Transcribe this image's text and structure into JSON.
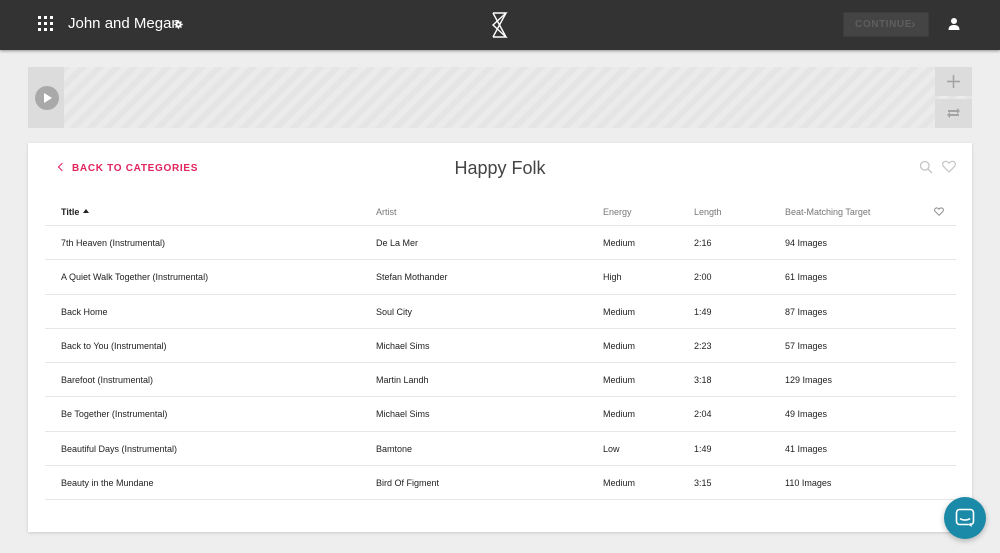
{
  "header": {
    "project_title": "John and Megan",
    "continue_label": "CONTINUE",
    "icons": {
      "apps": "apps-grid-icon",
      "settings": "gear-icon",
      "logo": "logo-icon",
      "user": "user-icon"
    }
  },
  "timeline": {
    "icons": {
      "play": "play-icon",
      "add": "plus-icon",
      "loop": "repeat-icon"
    }
  },
  "panel": {
    "back_label": "BACK TO CATEGORIES",
    "title": "Happy Folk",
    "icons": {
      "search": "search-icon",
      "favorites": "heart-icon"
    },
    "columns": {
      "title": "Title",
      "artist": "Artist",
      "energy": "Energy",
      "length": "Length",
      "beat": "Beat-Matching Target"
    },
    "rows": [
      {
        "title": "7th Heaven (Instrumental)",
        "artist": "De La Mer",
        "energy": "Medium",
        "length": "2:16",
        "beat": "94 Images"
      },
      {
        "title": "A Quiet Walk Together (Instrumental)",
        "artist": "Stefan Mothander",
        "energy": "High",
        "length": "2:00",
        "beat": "61 Images"
      },
      {
        "title": "Back Home",
        "artist": "Soul City",
        "energy": "Medium",
        "length": "1:49",
        "beat": "87 Images"
      },
      {
        "title": "Back to You (Instrumental)",
        "artist": "Michael Sims",
        "energy": "Medium",
        "length": "2:23",
        "beat": "57 Images"
      },
      {
        "title": "Barefoot (Instrumental)",
        "artist": "Martin Landh",
        "energy": "Medium",
        "length": "3:18",
        "beat": "129 Images"
      },
      {
        "title": "Be Together (Instrumental)",
        "artist": "Michael Sims",
        "energy": "Medium",
        "length": "2:04",
        "beat": "49 Images"
      },
      {
        "title": "Beautiful Days (Instrumental)",
        "artist": "Bamtone",
        "energy": "Low",
        "length": "1:49",
        "beat": "41 Images"
      },
      {
        "title": "Beauty in the Mundane",
        "artist": "Bird Of Figment",
        "energy": "Medium",
        "length": "3:15",
        "beat": "110 Images"
      }
    ]
  },
  "chat": {
    "icon": "chat-icon",
    "color": "#1b8aa8"
  },
  "colors": {
    "accent": "#e0245e",
    "topbar": "#333333"
  }
}
